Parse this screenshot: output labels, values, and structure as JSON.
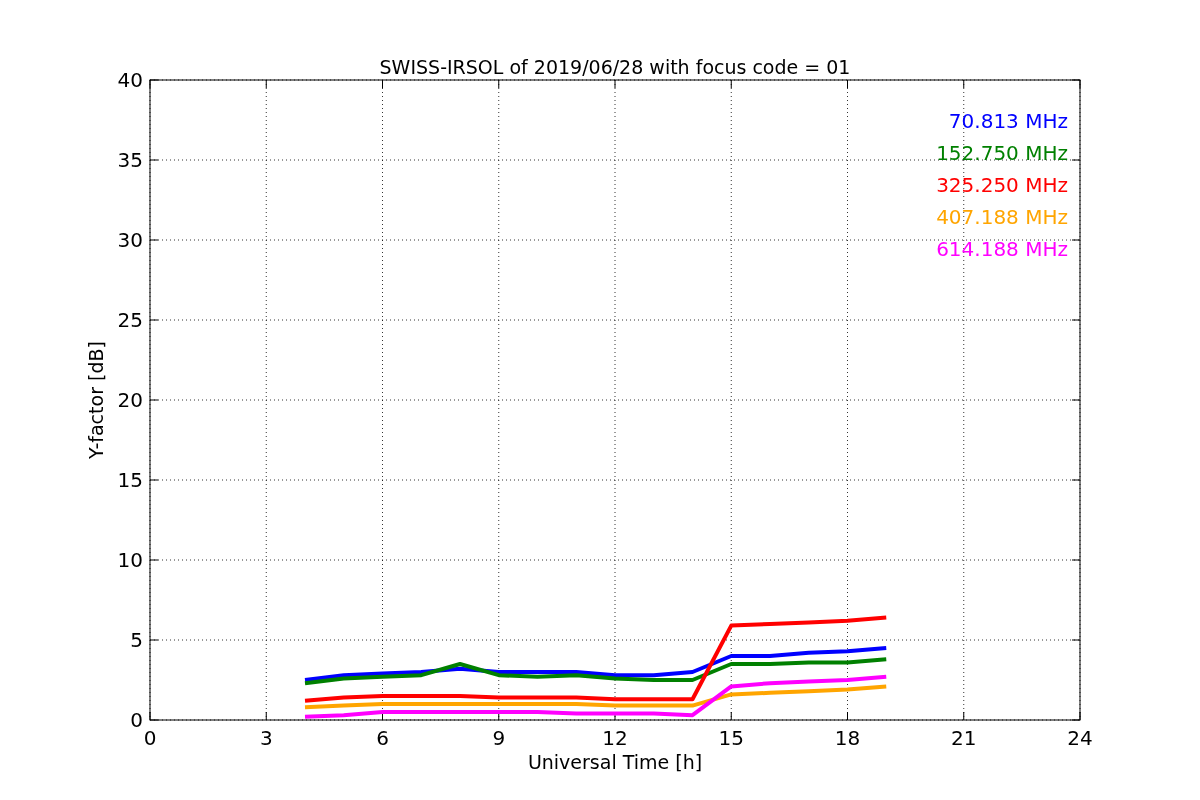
{
  "chart_data": {
    "type": "line",
    "title": "SWISS-IRSOL of 2019/06/28 with focus code = 01",
    "xlabel": "Universal Time [h]",
    "ylabel": "Y-factor [dB]",
    "x": [
      4,
      5,
      6,
      7,
      8,
      9,
      10,
      11,
      12,
      13,
      14,
      15,
      16,
      17,
      18,
      19
    ],
    "grid": true,
    "xlim": [
      0,
      24
    ],
    "ylim": [
      0,
      40
    ],
    "xticks": [
      0,
      3,
      6,
      9,
      12,
      15,
      18,
      21,
      24
    ],
    "yticks": [
      0,
      5,
      10,
      15,
      20,
      25,
      30,
      35,
      40
    ],
    "series": [
      {
        "name": "70.813 MHz",
        "color": "#0000ff",
        "values": [
          2.5,
          2.8,
          2.9,
          3,
          3.2,
          3,
          3,
          3,
          2.8,
          2.8,
          3,
          4,
          4,
          4.2,
          4.3,
          4.5
        ]
      },
      {
        "name": "152.750 MHz",
        "color": "#008000",
        "values": [
          2.3,
          2.6,
          2.7,
          2.8,
          3.5,
          2.8,
          2.7,
          2.8,
          2.6,
          2.5,
          2.5,
          3.5,
          3.5,
          3.6,
          3.6,
          3.8
        ]
      },
      {
        "name": "325.250 MHz",
        "color": "#ff0000",
        "values": [
          1.2,
          1.4,
          1.5,
          1.5,
          1.5,
          1.4,
          1.4,
          1.4,
          1.3,
          1.3,
          1.3,
          5.9,
          6,
          6.1,
          6.2,
          6.4
        ]
      },
      {
        "name": "407.188 MHz",
        "color": "#ffa500",
        "values": [
          0.8,
          0.9,
          1,
          1,
          1,
          1,
          1,
          1,
          0.9,
          0.9,
          0.9,
          1.6,
          1.7,
          1.8,
          1.9,
          2.1
        ]
      },
      {
        "name": "614.188 MHz",
        "color": "#ff00ff",
        "values": [
          0.2,
          0.3,
          0.5,
          0.5,
          0.5,
          0.5,
          0.5,
          0.4,
          0.4,
          0.4,
          0.3,
          2.1,
          2.3,
          2.4,
          2.5,
          2.7
        ]
      }
    ]
  }
}
